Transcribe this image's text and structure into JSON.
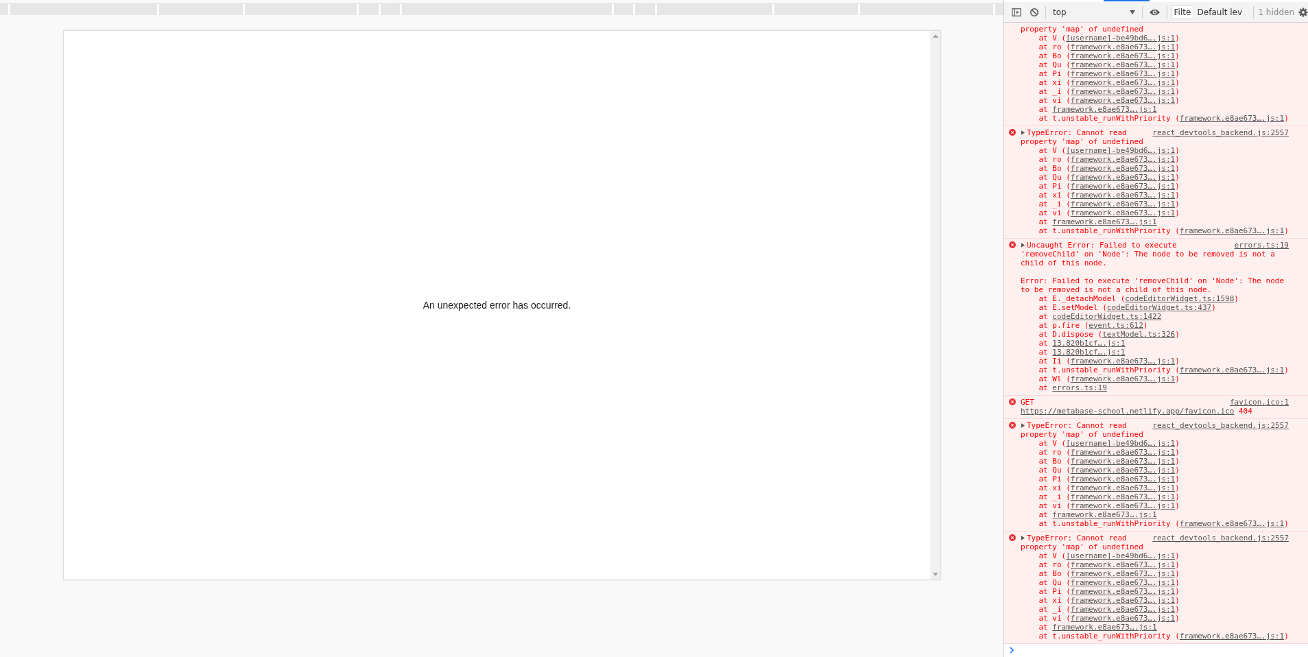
{
  "page": {
    "message": "An unexpected error has occurred."
  },
  "console_toolbar": {
    "context": "top",
    "filter": {
      "placeholder": "Filte"
    },
    "levels": "Default lev",
    "hidden_count": "1 hidden"
  },
  "messages": [
    {
      "kind": "continuation",
      "text": "property 'map' of undefined",
      "frames": [
        {
          "lead": "at V (",
          "link": "[username]-be49bd6….js:1",
          "trail": ")"
        },
        {
          "lead": "at ro (",
          "link": "framework.e8ae673….js:1",
          "trail": ")"
        },
        {
          "lead": "at Bo (",
          "link": "framework.e8ae673….js:1",
          "trail": ")"
        },
        {
          "lead": "at Qu (",
          "link": "framework.e8ae673….js:1",
          "trail": ")"
        },
        {
          "lead": "at Pi (",
          "link": "framework.e8ae673….js:1",
          "trail": ")"
        },
        {
          "lead": "at xi (",
          "link": "framework.e8ae673….js:1",
          "trail": ")"
        },
        {
          "lead": "at _i (",
          "link": "framework.e8ae673….js:1",
          "trail": ")"
        },
        {
          "lead": "at vi (",
          "link": "framework.e8ae673….js:1",
          "trail": ")"
        },
        {
          "lead": "at ",
          "link": "framework.e8ae673….js:1"
        },
        {
          "lead": "at t.unstable_runWithPriority (",
          "link": "framework.e8ae673….js:1",
          "trail": ")"
        }
      ]
    },
    {
      "kind": "group",
      "expanded": false,
      "source": "react_devtools_backend.js:2557",
      "text": "TypeError: Cannot read property 'map' of undefined",
      "frames": [
        {
          "lead": "at V (",
          "link": "[username]-be49bd6….js:1",
          "trail": ")"
        },
        {
          "lead": "at ro (",
          "link": "framework.e8ae673….js:1",
          "trail": ")"
        },
        {
          "lead": "at Bo (",
          "link": "framework.e8ae673….js:1",
          "trail": ")"
        },
        {
          "lead": "at Qu (",
          "link": "framework.e8ae673….js:1",
          "trail": ")"
        },
        {
          "lead": "at Pi (",
          "link": "framework.e8ae673….js:1",
          "trail": ")"
        },
        {
          "lead": "at xi (",
          "link": "framework.e8ae673….js:1",
          "trail": ")"
        },
        {
          "lead": "at _i (",
          "link": "framework.e8ae673….js:1",
          "trail": ")"
        },
        {
          "lead": "at vi (",
          "link": "framework.e8ae673….js:1",
          "trail": ")"
        },
        {
          "lead": "at ",
          "link": "framework.e8ae673….js:1"
        },
        {
          "lead": "at t.unstable_runWithPriority (",
          "link": "framework.e8ae673….js:1",
          "trail": ")"
        }
      ]
    },
    {
      "kind": "group",
      "expanded": false,
      "source": "errors.ts:19",
      "text": "Uncaught Error: Failed to execute 'removeChild' on 'Node': The node to be removed is not a child of this node.",
      "detail": "Error: Failed to execute 'removeChild' on 'Node': The node to be removed is not a child of this node.",
      "frames": [
        {
          "lead": "at E._detachModel (",
          "link": "codeEditorWidget.ts:1598",
          "trail": ")"
        },
        {
          "lead": "at E.setModel (",
          "link": "codeEditorWidget.ts:437",
          "trail": ")"
        },
        {
          "lead": "at ",
          "link": "codeEditorWidget.ts:1422"
        },
        {
          "lead": "at p.fire (",
          "link": "event.ts:612",
          "trail": ")"
        },
        {
          "lead": "at D.dispose (",
          "link": "textModel.ts:326",
          "trail": ")"
        },
        {
          "lead": "at ",
          "link": "13.820b1cf….js:1"
        },
        {
          "lead": "at ",
          "link": "13.820b1cf….js:1"
        },
        {
          "lead": "at Ii (",
          "link": "framework.e8ae673….js:1",
          "trail": ")"
        },
        {
          "lead": "at t.unstable_runWithPriority (",
          "link": "framework.e8ae673….js:1",
          "trail": ")"
        },
        {
          "lead": "at Wl (",
          "link": "framework.e8ae673….js:1",
          "trail": ")"
        },
        {
          "lead": "at ",
          "link": "errors.ts:19"
        }
      ]
    },
    {
      "kind": "network",
      "source": "favicon.ico:1",
      "method": "GET",
      "url": "https://metabase-school.netlify.app/favicon.ico",
      "status": "404"
    },
    {
      "kind": "group",
      "expanded": false,
      "source": "react_devtools_backend.js:2557",
      "text": "TypeError: Cannot read property 'map' of undefined",
      "frames": [
        {
          "lead": "at V (",
          "link": "[username]-be49bd6….js:1",
          "trail": ")"
        },
        {
          "lead": "at ro (",
          "link": "framework.e8ae673….js:1",
          "trail": ")"
        },
        {
          "lead": "at Bo (",
          "link": "framework.e8ae673….js:1",
          "trail": ")"
        },
        {
          "lead": "at Qu (",
          "link": "framework.e8ae673….js:1",
          "trail": ")"
        },
        {
          "lead": "at Pi (",
          "link": "framework.e8ae673….js:1",
          "trail": ")"
        },
        {
          "lead": "at xi (",
          "link": "framework.e8ae673….js:1",
          "trail": ")"
        },
        {
          "lead": "at _i (",
          "link": "framework.e8ae673….js:1",
          "trail": ")"
        },
        {
          "lead": "at vi (",
          "link": "framework.e8ae673….js:1",
          "trail": ")"
        },
        {
          "lead": "at ",
          "link": "framework.e8ae673….js:1"
        },
        {
          "lead": "at t.unstable_runWithPriority (",
          "link": "framework.e8ae673….js:1",
          "trail": ")"
        }
      ]
    },
    {
      "kind": "group",
      "expanded": false,
      "source": "react_devtools_backend.js:2557",
      "text": "TypeError: Cannot read property 'map' of undefined",
      "frames": [
        {
          "lead": "at V (",
          "link": "[username]-be49bd6….js:1",
          "trail": ")"
        },
        {
          "lead": "at ro (",
          "link": "framework.e8ae673….js:1",
          "trail": ")"
        },
        {
          "lead": "at Bo (",
          "link": "framework.e8ae673….js:1",
          "trail": ")"
        },
        {
          "lead": "at Qu (",
          "link": "framework.e8ae673….js:1",
          "trail": ")"
        },
        {
          "lead": "at Pi (",
          "link": "framework.e8ae673….js:1",
          "trail": ")"
        },
        {
          "lead": "at xi (",
          "link": "framework.e8ae673….js:1",
          "trail": ")"
        },
        {
          "lead": "at _i (",
          "link": "framework.e8ae673….js:1",
          "trail": ")"
        },
        {
          "lead": "at vi (",
          "link": "framework.e8ae673….js:1",
          "trail": ")"
        },
        {
          "lead": "at ",
          "link": "framework.e8ae673….js:1"
        },
        {
          "lead": "at t.unstable_runWithPriority (",
          "link": "framework.e8ae673….js:1",
          "trail": ")"
        }
      ]
    }
  ]
}
